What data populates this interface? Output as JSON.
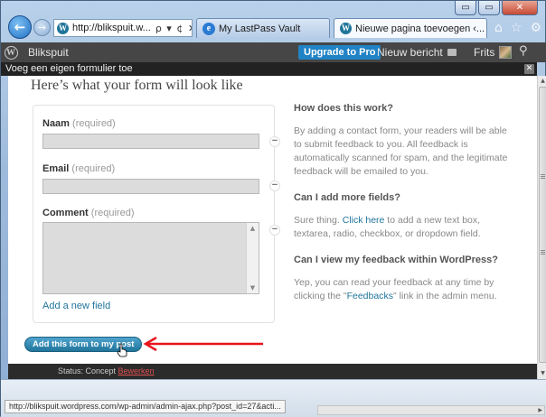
{
  "browser": {
    "address": "http://blikspuit.w...",
    "address_tools": "ρ ▾ ¢ ✕",
    "tabs": [
      {
        "label": "My LastPass Vault"
      },
      {
        "label": "Nieuwe pagina toevoegen ‹..."
      }
    ],
    "tab_close": "✕",
    "caption": {
      "minimize": "▭",
      "maximize": "▭",
      "close": "✕"
    },
    "nav_icons": [
      "⌂",
      "☆",
      "⚙"
    ]
  },
  "adminbar": {
    "site": "Blikspuit",
    "upgrade": "Upgrade to Pro",
    "new_post": "Nieuw bericht",
    "user": "Frits"
  },
  "modal": {
    "title": "Voeg een eigen formulier toe",
    "close": "✕"
  },
  "form": {
    "heading": "Here’s what your form will look like",
    "fields": [
      {
        "label": "Naam",
        "required": "(required)"
      },
      {
        "label": "Email",
        "required": "(required)"
      },
      {
        "label": "Comment",
        "required": "(required)"
      }
    ],
    "add_field": "Add a new field",
    "remove_symbol": "−"
  },
  "help": {
    "q1": "How does this work?",
    "a1": "By adding a contact form, your readers will be able to submit feedback to you. All feedback is automatically scanned for spam, and the legitimate feedback will be emailed to you.",
    "q2": "Can I add more fields?",
    "a2_pre": "Sure thing. ",
    "a2_link": "Click here",
    "a2_post": " to add a new text box, textarea, radio, checkbox, or dropdown field.",
    "q3": "Can I view my feedback within WordPress?",
    "a3_pre": "Yep, you can read your feedback at any time by clicking the \"",
    "a3_link": "Feedbacks",
    "a3_post": "\" link in the admin menu."
  },
  "action": {
    "add_form_button": "Add this form to my post"
  },
  "page_status": {
    "label": "Status: Concept ",
    "edit_link": "Bewerken"
  },
  "statusbar": {
    "url": "http://blikspuit.wordpress.com/wp-admin/admin-ajax.php?post_id=27&acti..."
  },
  "colors": {
    "adminbar": "#464646",
    "link": "#21759b",
    "button": "#21759b",
    "arrow": "#e8141c",
    "upgrade": "#2183c5"
  }
}
